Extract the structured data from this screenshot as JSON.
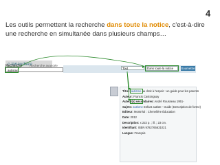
{
  "slide": {
    "number": "4"
  },
  "intro": {
    "before": "Les outils permettent la recherche ",
    "highlight": "dans toute la notice",
    "after": ", c'est-à-dire une recherche en simultanée dans plusieurs champs…"
  },
  "catalog": {
    "logo_text": "c-lanaudière",
    "search_label": "Recherche",
    "advanced_link": "Recherche avancée",
    "query_value": "autisme",
    "scope_value": "Tout",
    "field_value": "Dans toute la notice",
    "submit_label": "Soumettre"
  },
  "record": {
    "rows": [
      {
        "label": "Titre :",
        "value": "autisme",
        "rest": " au droit à l'espoir : un guide pour les parents"
      },
      {
        "label": "Auteur:",
        "value": "",
        "rest": "Francis Castonguay"
      },
      {
        "label": "Auteur(s) secondaires:",
        "value": "",
        "rest": "André Rousseau 1951-"
      },
      {
        "label": "Sujets:",
        "value": "autisme",
        "rest": " Enfant autiste - Guide (Description de forme)"
      },
      {
        "label": "Editeur:",
        "value": "",
        "rest": "Montréal : Chenelière Éducation"
      },
      {
        "label": "Date:",
        "value": "",
        "rest": "2012"
      },
      {
        "label": "Description:",
        "value": "",
        "rest": "x 222 p. ; ill. ; 23 cm."
      },
      {
        "label": "Identifiant:",
        "value": "",
        "rest": "ISBN 9782765631021"
      },
      {
        "label": "Langue:",
        "value": "",
        "rest": "Français"
      }
    ]
  },
  "colors": {
    "accent": "#e08a00",
    "highlight_box": "#2e8b2e",
    "submit": "#3a7ba8"
  }
}
